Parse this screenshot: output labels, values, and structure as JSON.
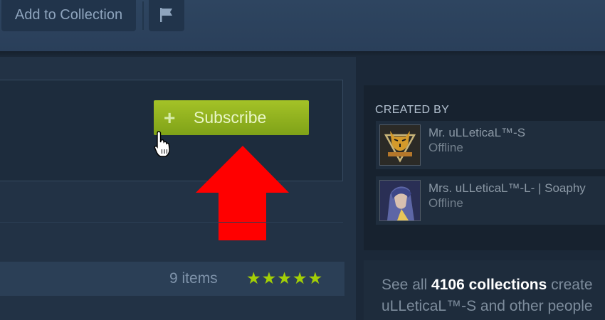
{
  "toolbar": {
    "add_to_collection_label": "Add to Collection",
    "flag_icon": "flag-icon"
  },
  "subscribe": {
    "label": "Subscribe",
    "icon": "plus-icon",
    "accent_color": "#8fb224"
  },
  "annotation": {
    "arrow_color": "#ff0000",
    "arrow_icon": "up-arrow-icon"
  },
  "collection": {
    "items_count": "9 items",
    "stars": "★★★★★",
    "rating": 5,
    "rating_max": 5
  },
  "created_by": {
    "heading": "CREATED BY",
    "creators": [
      {
        "name": "Mr. uLLeticaL™-S",
        "status": "Offline",
        "avatar_icon": "tiger-emblem-avatar"
      },
      {
        "name": "Mrs. uLLeticaL™-L- | Soaphy",
        "status": "Offline",
        "avatar_icon": "anime-character-avatar"
      }
    ]
  },
  "see_all": {
    "prefix": "See all ",
    "count_text": "4106 collections",
    "suffix_line1": " create",
    "line2": "uLLeticaL™-S and other people"
  }
}
